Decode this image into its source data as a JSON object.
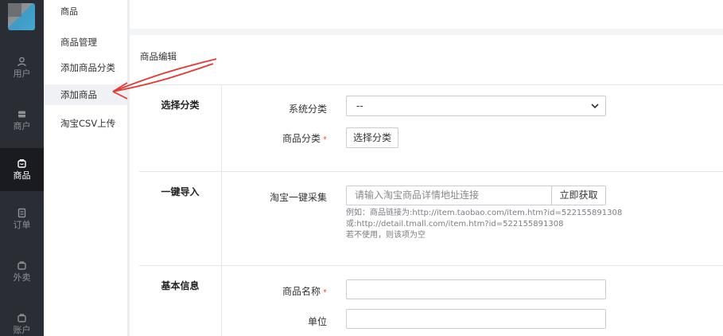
{
  "rail": {
    "items": [
      {
        "label": "用户",
        "icon": "user-icon"
      },
      {
        "label": "商户",
        "icon": "store-icon"
      },
      {
        "label": "商品",
        "icon": "goods-icon"
      },
      {
        "label": "订单",
        "icon": "order-icon"
      },
      {
        "label": "外卖",
        "icon": "takeout-icon"
      },
      {
        "label": "账户",
        "icon": "account-icon"
      }
    ],
    "active": "商品"
  },
  "submenu": {
    "title": "商品",
    "items": [
      {
        "label": "商品管理"
      },
      {
        "label": "添加商品分类"
      },
      {
        "label": "添加商品"
      },
      {
        "label": "淘宝CSV上传"
      }
    ],
    "active": "添加商品"
  },
  "content": {
    "title": "商品编辑",
    "category_section": {
      "label": "选择分类",
      "system_category_label": "系统分类",
      "system_category_value": "--",
      "goods_category_label": "商品分类",
      "goods_category_required": "*",
      "choose_button": "选择分类"
    },
    "import_section": {
      "label": "一键导入",
      "taobao_label": "淘宝一键采集",
      "url_placeholder": "请输入淘宝商品详情地址连接",
      "fetch_button": "立即获取",
      "hint_line1": "例如：商品链接为:http://item.taobao.com/item.htm?id=522155891308",
      "hint_line2": "或:http://detail.tmall.com/item.htm?id=522155891308",
      "hint_line3": "若不使用，则该项为空"
    },
    "basic_section": {
      "label": "基本信息",
      "name_label": "商品名称",
      "name_required": "*",
      "unit_label": "单位"
    }
  },
  "colors": {
    "rail_bg": "#2b2d35",
    "rail_active_bg": "#1a1b20",
    "arrow": "#e53935",
    "required": "#e5534b"
  }
}
